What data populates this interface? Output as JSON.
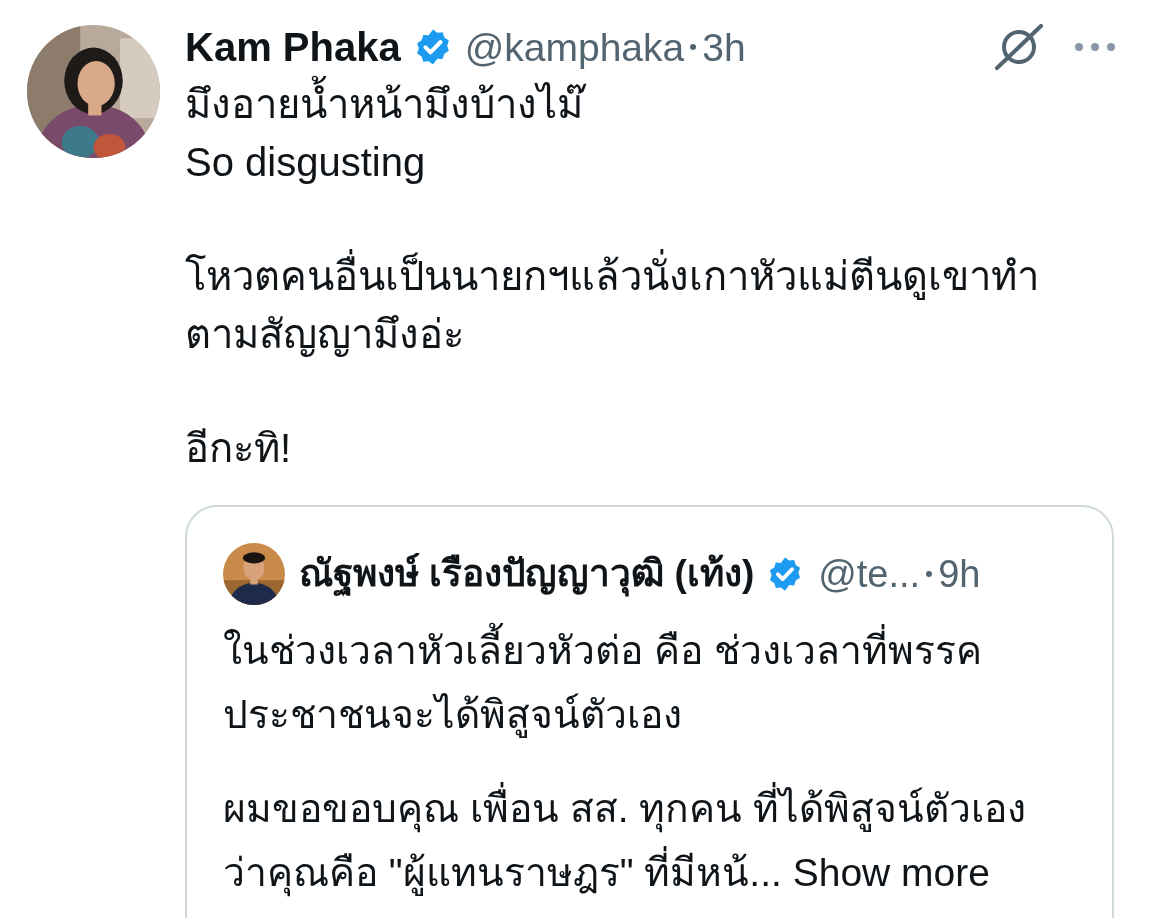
{
  "tweet": {
    "author": {
      "name": "Kam Phaka",
      "verified": true,
      "handle": "@kamphaka",
      "time": "3h"
    },
    "paragraphs": [
      "มึงอายน้ำหน้ามึงบ้างไม๊\nSo disgusting",
      "โหวตคนอื่นเป็นนายกฯแล้วนั่งเกาหัวแม่ตีนดูเขาทำตามสัญญามึงอ่ะ",
      "อีกะทิ!"
    ],
    "quote": {
      "author": {
        "name": "ณัฐพงษ์ เรืองปัญญาวุฒิ (เท้ง)",
        "verified": true,
        "handle": "@te...",
        "time": "9h"
      },
      "paragraphs": [
        "ในช่วงเวลาหัวเลี้ยวหัวต่อ คือ ช่วงเวลาที่พรรคประชาชนจะได้พิสูจน์ตัวเอง",
        "ผมขอขอบคุณ เพื่อน สส. ทุกคน ที่ได้พิสูจน์ตัวเองว่าคุณคือ \"ผู้แทนราษฎร\" ที่มีหน้..."
      ],
      "show_more": "Show more"
    }
  }
}
